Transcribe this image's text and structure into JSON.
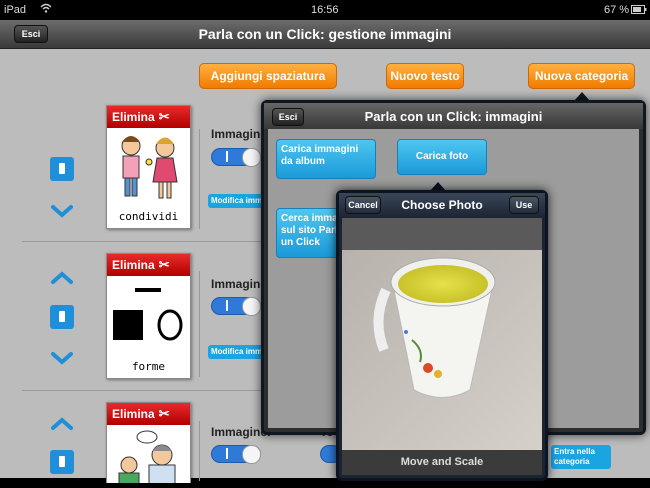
{
  "status_bar": {
    "device": "iPad",
    "time": "16:56",
    "battery": "67 %"
  },
  "nav": {
    "title": "Parla con un Click: gestione immagini",
    "exit_label": "Esci"
  },
  "toolbar": {
    "add_spacing": "Aggiungi spaziatura",
    "new_text": "Nuovo testo",
    "new_category": "Nuova categoria"
  },
  "rows": [
    {
      "delete_label": "Elimina",
      "caption": "condividi",
      "image_label": "Immagine",
      "modify_label": "Modifica imm"
    },
    {
      "delete_label": "Elimina",
      "caption": "forme",
      "image_label": "Immagine",
      "modify_label": "Modifica imm"
    },
    {
      "delete_label": "Elimina",
      "caption": "",
      "image_label": "Immagine:",
      "modify_label": ""
    }
  ],
  "row3_right": {
    "te_label": "Te",
    "enter_category": "Entra nella categoria"
  },
  "images_popover": {
    "title": "Parla con un Click: immagini",
    "exit_label": "Esci",
    "load_album": "Carica immagini da album",
    "load_photo": "Carica foto",
    "search_site": "Cerca imma sul sito Parl un Click"
  },
  "photo_picker": {
    "title": "Choose Photo",
    "cancel": "Cancel",
    "use": "Use",
    "footer": "Move and Scale"
  },
  "colors": {
    "orange": "#f07b00",
    "delete_red": "#c40000",
    "blue": "#1e8fd8",
    "cyan": "#1ba4e2"
  }
}
